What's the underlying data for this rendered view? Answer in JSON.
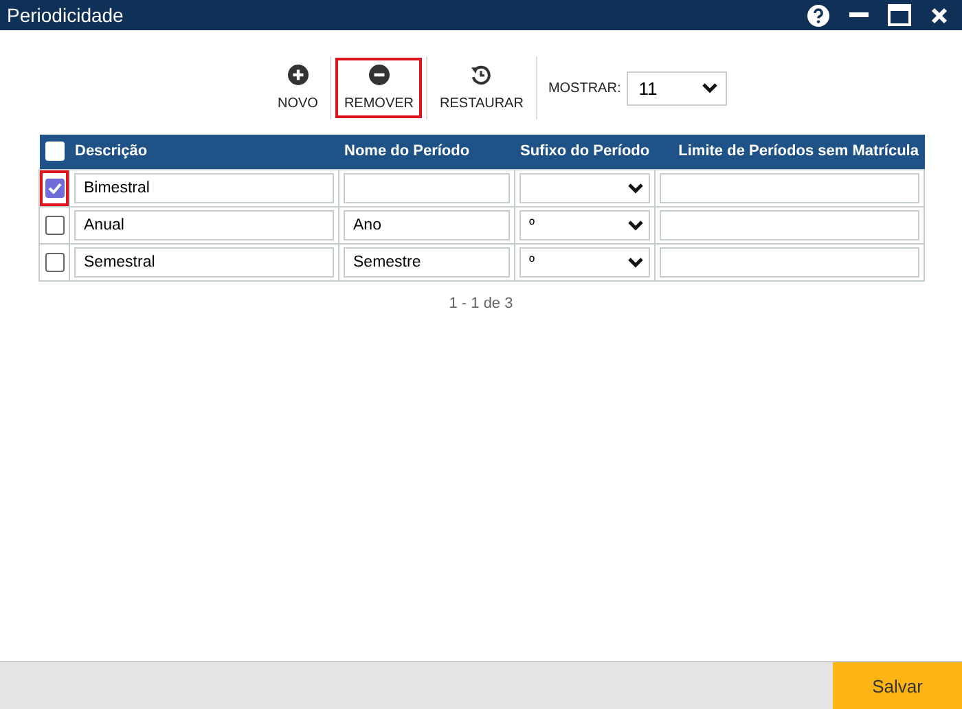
{
  "window": {
    "title": "Periodicidade"
  },
  "toolbar": {
    "buttons": [
      {
        "kind": "add",
        "label": "NOVO",
        "highlighted": false
      },
      {
        "kind": "remove",
        "label": "REMOVER",
        "highlighted": true
      },
      {
        "kind": "restore",
        "label": "RESTAURAR",
        "highlighted": false
      }
    ],
    "show_label": "MOSTRAR:",
    "show_value": "11"
  },
  "table": {
    "select_all": false,
    "columns": [
      "Descrição",
      "Nome do Período",
      "Sufixo do Período",
      "Limite de Períodos sem Matrícula"
    ],
    "rows": [
      {
        "selected": true,
        "highlighted": true,
        "description": "Bimestral",
        "period_name": "",
        "suffix": ""
      },
      {
        "selected": false,
        "highlighted": false,
        "description": "Anual",
        "period_name": "Ano",
        "suffix": "º"
      },
      {
        "selected": false,
        "highlighted": false,
        "description": "Semestral",
        "period_name": "Semestre",
        "suffix": "º"
      }
    ]
  },
  "pagination": "1 - 1 de 3",
  "footer": {
    "save_button": "Salvar"
  }
}
